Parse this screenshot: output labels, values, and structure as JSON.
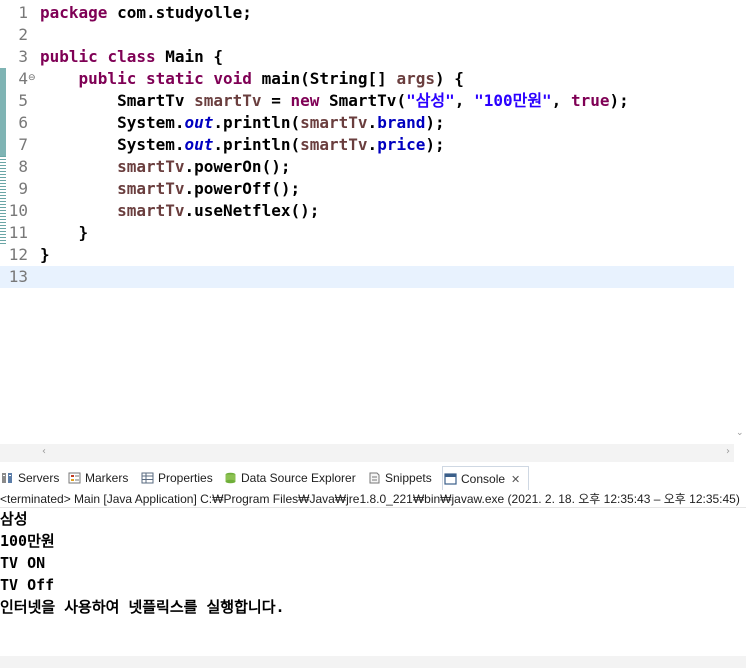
{
  "editor": {
    "lines": [
      {
        "num": "1",
        "tokens": [
          {
            "t": "package",
            "c": "kw"
          },
          {
            "t": " com.studyolle;",
            "c": ""
          }
        ]
      },
      {
        "num": "2",
        "tokens": []
      },
      {
        "num": "3",
        "tokens": [
          {
            "t": "public",
            "c": "kw"
          },
          {
            "t": " ",
            "c": ""
          },
          {
            "t": "class",
            "c": "kw"
          },
          {
            "t": " Main {",
            "c": ""
          }
        ]
      },
      {
        "num": "4",
        "fold": "⊖",
        "tokens": [
          {
            "t": "    ",
            "c": ""
          },
          {
            "t": "public",
            "c": "kw"
          },
          {
            "t": " ",
            "c": ""
          },
          {
            "t": "static",
            "c": "kw"
          },
          {
            "t": " ",
            "c": ""
          },
          {
            "t": "void",
            "c": "kw"
          },
          {
            "t": " main(String[] ",
            "c": ""
          },
          {
            "t": "args",
            "c": "loc"
          },
          {
            "t": ") {",
            "c": ""
          }
        ]
      },
      {
        "num": "5",
        "tokens": [
          {
            "t": "        SmartTv ",
            "c": ""
          },
          {
            "t": "smartTv",
            "c": "loc"
          },
          {
            "t": " = ",
            "c": ""
          },
          {
            "t": "new",
            "c": "kw"
          },
          {
            "t": " SmartTv(",
            "c": ""
          },
          {
            "t": "\"삼성\"",
            "c": "str"
          },
          {
            "t": ", ",
            "c": ""
          },
          {
            "t": "\"100만원\"",
            "c": "str"
          },
          {
            "t": ", ",
            "c": ""
          },
          {
            "t": "true",
            "c": "kw"
          },
          {
            "t": ");",
            "c": ""
          }
        ]
      },
      {
        "num": "6",
        "tokens": [
          {
            "t": "        System.",
            "c": ""
          },
          {
            "t": "out",
            "c": "stf"
          },
          {
            "t": ".println(",
            "c": ""
          },
          {
            "t": "smartTv",
            "c": "loc"
          },
          {
            "t": ".",
            "c": ""
          },
          {
            "t": "brand",
            "c": "fld"
          },
          {
            "t": ");",
            "c": ""
          }
        ]
      },
      {
        "num": "7",
        "tokens": [
          {
            "t": "        System.",
            "c": ""
          },
          {
            "t": "out",
            "c": "stf"
          },
          {
            "t": ".println(",
            "c": ""
          },
          {
            "t": "smartTv",
            "c": "loc"
          },
          {
            "t": ".",
            "c": ""
          },
          {
            "t": "price",
            "c": "fld"
          },
          {
            "t": ");",
            "c": ""
          }
        ]
      },
      {
        "num": "8",
        "tokens": [
          {
            "t": "        ",
            "c": ""
          },
          {
            "t": "smartTv",
            "c": "loc"
          },
          {
            "t": ".powerOn();",
            "c": ""
          }
        ]
      },
      {
        "num": "9",
        "tokens": [
          {
            "t": "        ",
            "c": ""
          },
          {
            "t": "smartTv",
            "c": "loc"
          },
          {
            "t": ".powerOff();",
            "c": ""
          }
        ]
      },
      {
        "num": "10",
        "tokens": [
          {
            "t": "        ",
            "c": ""
          },
          {
            "t": "smartTv",
            "c": "loc"
          },
          {
            "t": ".useNetflex();",
            "c": ""
          }
        ]
      },
      {
        "num": "11",
        "tokens": [
          {
            "t": "    }",
            "c": ""
          }
        ]
      },
      {
        "num": "12",
        "tokens": [
          {
            "t": "}",
            "c": ""
          }
        ]
      },
      {
        "num": "13",
        "tokens": [],
        "current": true
      }
    ]
  },
  "tabs": [
    {
      "label": "Servers",
      "icon": "servers-icon"
    },
    {
      "label": "Markers",
      "icon": "markers-icon"
    },
    {
      "label": "Properties",
      "icon": "properties-icon"
    },
    {
      "label": "Data Source Explorer",
      "icon": "data-source-explorer-icon"
    },
    {
      "label": "Snippets",
      "icon": "snippets-icon"
    },
    {
      "label": "Console",
      "icon": "console-icon",
      "active": true,
      "close": "✕"
    }
  ],
  "console": {
    "status": "<terminated> Main [Java Application] C:₩Program Files₩Java₩jre1.8.0_221₩bin₩javaw.exe  (2021. 2. 18. 오후 12:35:43 – 오후 12:35:45)",
    "output": [
      "삼성",
      "100만원",
      "TV ON",
      "TV Off",
      "인터넷을 사용하여 넷플릭스를 실행합니다."
    ]
  },
  "colors": {
    "keyword": "#7f0055",
    "local_variable": "#6a3e3e",
    "field": "#0000c0",
    "string": "#2a00ff",
    "current_line": "#e8f2fe",
    "quick_diff": "#7fb4b4"
  }
}
